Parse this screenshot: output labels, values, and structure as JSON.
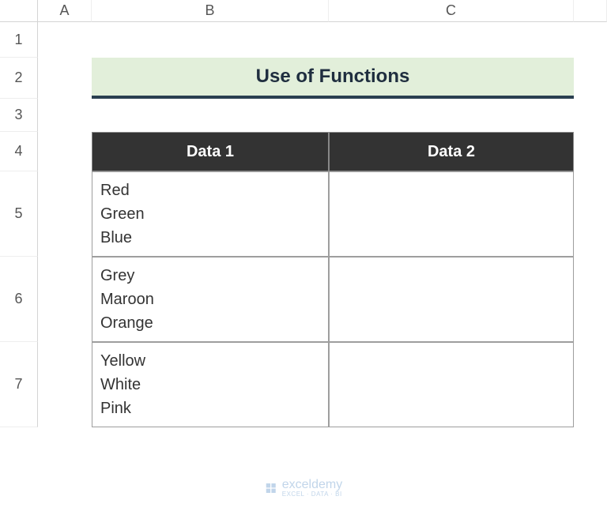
{
  "columns": {
    "A": "A",
    "B": "B",
    "C": "C"
  },
  "rows": {
    "1": "1",
    "2": "2",
    "3": "3",
    "4": "4",
    "5": "5",
    "6": "6",
    "7": "7"
  },
  "title": "Use of Functions",
  "table": {
    "headers": {
      "col1": "Data 1",
      "col2": "Data 2"
    },
    "rows": [
      {
        "data1": "Red\nGreen\nBlue",
        "data2": ""
      },
      {
        "data1": "Grey\nMaroon\nOrange",
        "data2": ""
      },
      {
        "data1": "Yellow\nWhite\nPink",
        "data2": ""
      }
    ]
  },
  "watermark": {
    "main": "exceldemy",
    "sub": "EXCEL · DATA · BI"
  },
  "chart_data": {
    "type": "table",
    "title": "Use of Functions",
    "columns": [
      "Data 1",
      "Data 2"
    ],
    "rows": [
      [
        "Red\nGreen\nBlue",
        ""
      ],
      [
        "Grey\nMaroon\nOrange",
        ""
      ],
      [
        "Yellow\nWhite\nPink",
        ""
      ]
    ]
  }
}
